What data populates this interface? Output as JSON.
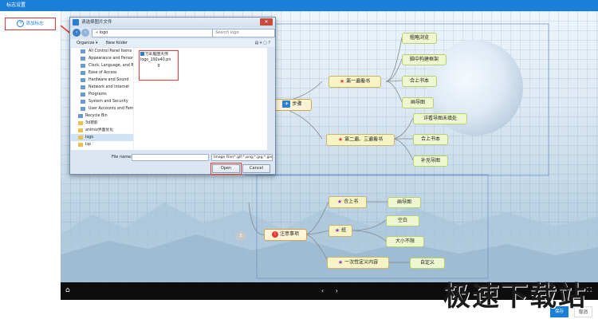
{
  "window": {
    "title": "标志设置"
  },
  "left_panel": {
    "add_mark_label": "添加标志"
  },
  "mindmap": {
    "root_badge": "3",
    "nodes": {
      "steps": "步骤",
      "first_read": "第一遍看书",
      "first_children": [
        "粗略浏览",
        "脑中构建框架",
        "合上书本",
        "画导图"
      ],
      "second_read": "第二遍、三遍看书",
      "second_children": [
        "详看导图未填处",
        "合上书本",
        "补充导图"
      ],
      "notes": "注意事项",
      "close_book": "合上书",
      "draw_map": "画导图",
      "paper": "纸",
      "paper_children": [
        "空白",
        "大小不限"
      ],
      "one_time": "一次性定义内容",
      "custom": "自定义"
    }
  },
  "dialog": {
    "title": "请选择图片文件",
    "close_label": "✕",
    "address": "« logo",
    "search_placeholder": "Search logo",
    "toolbar": {
      "organize": "Organize ▾",
      "new_folder": "New folder"
    },
    "tree": [
      {
        "label": "All Control Panel Items",
        "indent": true
      },
      {
        "label": "Appearance and Personalization",
        "indent": true
      },
      {
        "label": "Clock, Language, and Region",
        "indent": true
      },
      {
        "label": "Ease of Access",
        "indent": true
      },
      {
        "label": "Hardware and Sound",
        "indent": true
      },
      {
        "label": "Network and Internet",
        "indent": true
      },
      {
        "label": "Programs",
        "indent": true
      },
      {
        "label": "System and Security",
        "indent": true
      },
      {
        "label": "User Accounts and Family Safety",
        "indent": true
      },
      {
        "label": "Recycle Bin",
        "indent": false
      },
      {
        "label": "3d荷影",
        "indent": false
      },
      {
        "label": "animiz界面优化",
        "indent": false
      },
      {
        "label": "logo",
        "indent": false
      },
      {
        "label": "lsp",
        "indent": false
      }
    ],
    "file_card": {
      "line1": "万彩脑图大师",
      "line2": "logo_192x40.pn",
      "line3": "g"
    },
    "file_name_label": "File name:",
    "file_filter": "Image File(*.gif;*.png;*.jpg;*.jpe",
    "open_label": "Open",
    "cancel_label": "Cancel"
  },
  "player": {
    "home_icon": "⌂",
    "arrows": "‹ ›",
    "fullscreen_icon": "⛶"
  },
  "footer": {
    "save_label": "保存",
    "cancel_label": "取消"
  },
  "watermark": "极速下载站"
}
